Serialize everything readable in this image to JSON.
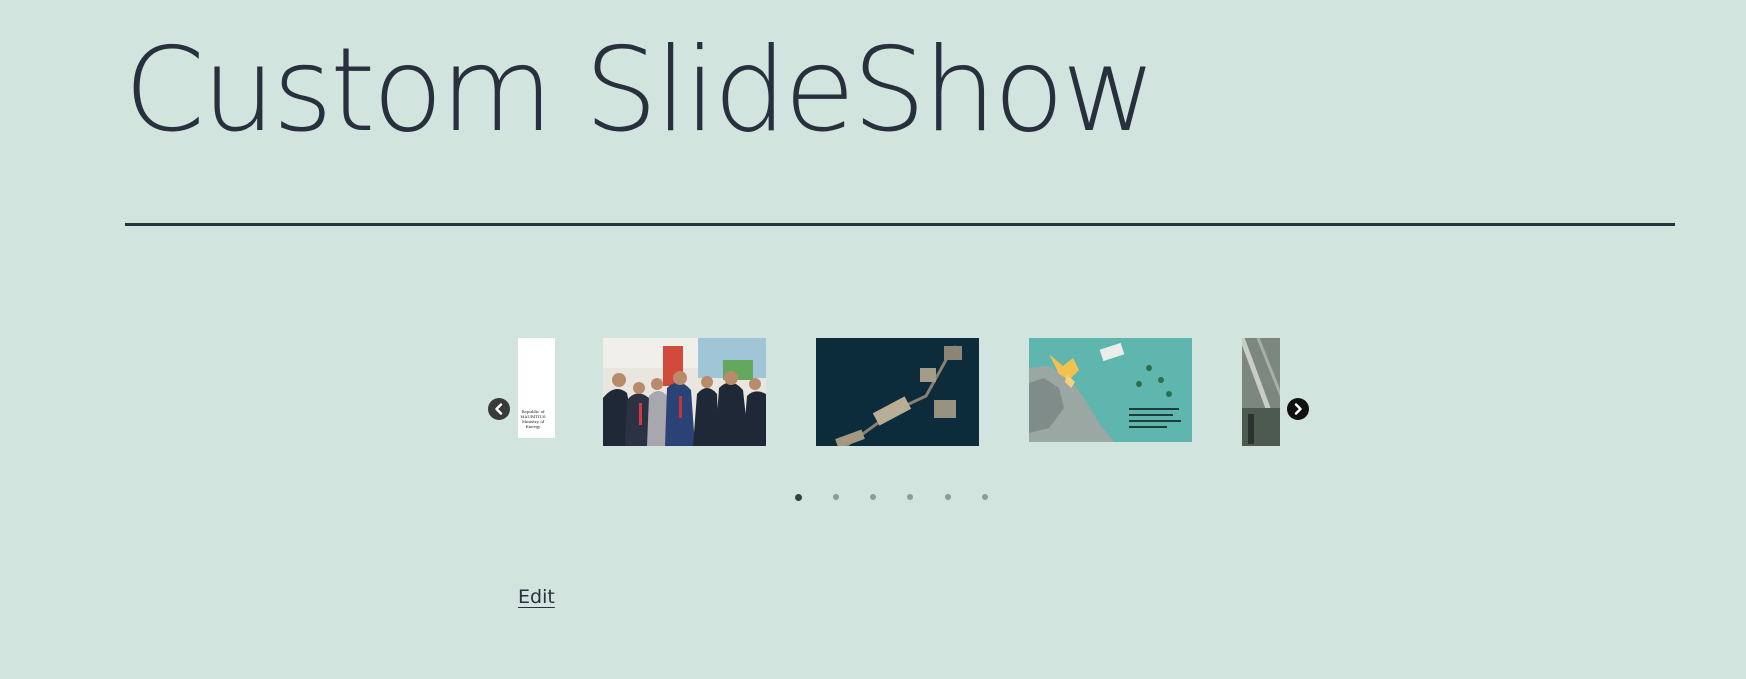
{
  "page": {
    "title": "Custom SlideShow",
    "edit_label": "Edit"
  },
  "slideshow": {
    "slides": [
      {
        "name": "slide-logo-ministry",
        "logo_line_1": "Republic of MAURITIUS",
        "logo_line_2": "Ministry of Energy",
        "icon": "ministry-logo"
      },
      {
        "name": "slide-officials-handshake",
        "icon": "photo-people"
      },
      {
        "name": "slide-offshore-platform-aerial",
        "icon": "photo-offshore"
      },
      {
        "name": "slide-offshore-map-board",
        "icon": "photo-map"
      },
      {
        "name": "slide-industrial-structure",
        "icon": "photo-industrial"
      }
    ],
    "dots_count": 6,
    "active_dot_index": 0,
    "prev_icon": "chevron-left-icon",
    "next_icon": "chevron-right-icon"
  },
  "colors": {
    "background": "#d1e4dd",
    "text": "#28303d",
    "dot_inactive": "#8d9a96",
    "dot_active": "#3a3f44"
  }
}
